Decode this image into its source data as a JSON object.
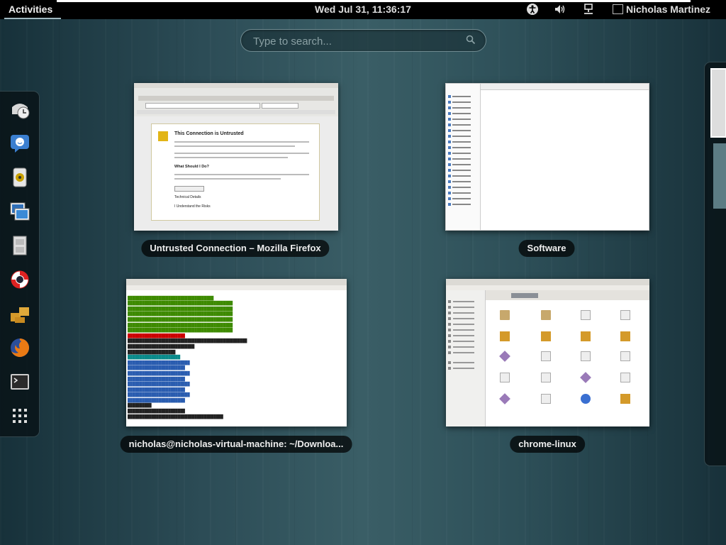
{
  "topbar": {
    "activities": "Activities",
    "clock": "Wed Jul 31, 11:36:17",
    "user": "Nicholas Martinez",
    "indicators": {
      "accessibility": "accessibility-icon",
      "volume": "volume-icon",
      "network": "network-icon"
    }
  },
  "search": {
    "placeholder": "Type to search..."
  },
  "dash": {
    "items": [
      "clock-icon",
      "empathy-chat-icon",
      "rhythmbox-icon",
      "shotwell-icon",
      "file-cabinet-icon",
      "help-lifebuoy-icon",
      "files-package-icon",
      "firefox-icon",
      "terminal-icon",
      "show-applications-icon"
    ]
  },
  "windows": {
    "firefox": {
      "caption": "Untrusted Connection – Mozilla Firefox",
      "page_title": "This Connection is Untrusted",
      "section": "What Should I Do?",
      "technical": "Technical Details",
      "understand": "I Understand the Risks"
    },
    "software": {
      "caption": "Software"
    },
    "terminal": {
      "caption": "nicholas@nicholas-virtual-machine: ~/Downloa..."
    },
    "files": {
      "caption": "chrome-linux"
    }
  },
  "colors": {
    "topbar_bg": "#000000",
    "dash_bg": "#08161a",
    "caption_bg": "#000000"
  }
}
